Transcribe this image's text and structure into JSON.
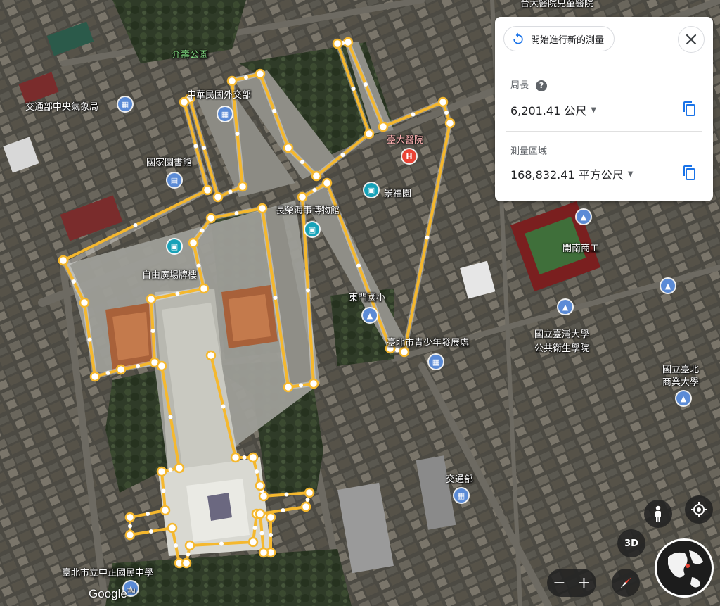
{
  "panel": {
    "new_measure_label": "開始進行新的測量",
    "perimeter_label": "周長",
    "perimeter_value": "6,201.41 公尺",
    "area_label": "測量區域",
    "area_value": "168,832.41 平方公尺"
  },
  "map_labels": {
    "jieshou_park": "介壽公園",
    "mofa": "中華民國外交部",
    "cwb": "交通部中央氣象局",
    "ntuh_child": "台大醫院兒童醫院",
    "ntuh": "臺大醫院",
    "national_library": "國家圖書館",
    "jingfu_gate": "景福園",
    "maritime_museum": "長榮海事博物館",
    "liberty_square": "自由廣場牌樓",
    "kainan_school": "開南商工",
    "dongmen_elementary": "東門國小",
    "youth_center": "臺北市青少年發展處",
    "ntu_public_health_1": "國立臺灣大學",
    "ntu_public_health_2": "公共衛生學院",
    "ntub_1": "國立臺北",
    "ntub_2": "商業大學",
    "motc": "交通部",
    "zhongzheng_school": "臺北市立中正國民中學"
  },
  "controls": {
    "btn_3d": "3D",
    "zoom_out": "−",
    "zoom_in": "+",
    "logo": "Google",
    "logo_tm": "TM"
  },
  "colors": {
    "measure_line": "#f5b82e",
    "panel_icon_blue": "#1a73e8"
  }
}
